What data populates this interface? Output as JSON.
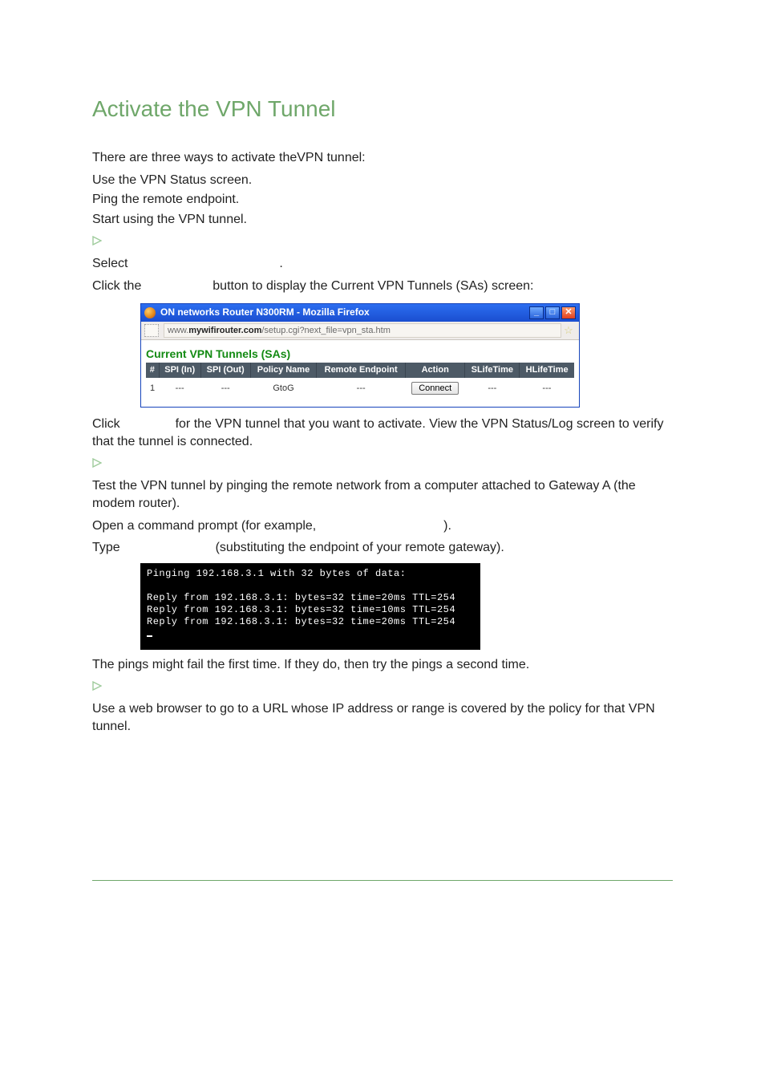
{
  "heading": "Activate the VPN Tunnel",
  "intro": "There are three ways to activate theVPN tunnel:",
  "ways": [
    "Use the VPN Status screen.",
    "Ping the remote endpoint.",
    "Start using the VPN tunnel."
  ],
  "sectionA": {
    "step1_pre": "Select",
    "step1_post": ".",
    "step2_pre": "Click the",
    "step2_post": "button to display the Current VPN Tunnels (SAs) screen:",
    "click_connect_pre": "Click",
    "click_connect_post": "for the VPN tunnel that you want to activate. View the VPN Status/Log screen to verify that the tunnel is connected."
  },
  "firefox": {
    "title": "ON networks Router N300RM - Mozilla Firefox",
    "url_plain_prefix": "www.",
    "url_bold": "mywifirouter.com",
    "url_plain_suffix": "/setup.cgi?next_file=vpn_sta.htm",
    "panel_title": "Current VPN Tunnels (SAs)",
    "win_min": "_",
    "win_max": "□",
    "win_close": "✕",
    "star": "☆",
    "headers": [
      "#",
      "SPI (In)",
      "SPI (Out)",
      "Policy Name",
      "Remote Endpoint",
      "Action",
      "SLifeTime",
      "HLifeTime"
    ],
    "row": {
      "num": "1",
      "spi_in": "---",
      "spi_out": "---",
      "policy": "GtoG",
      "remote": "---",
      "action_label": "Connect",
      "slife": "---",
      "hlife": "---"
    }
  },
  "sectionB": {
    "p1": "Test the VPN tunnel by pinging the remote network from a computer attached to Gateway A (the modem router).",
    "p2_pre": "Open a command prompt (for example,",
    "p2_post": ").",
    "p3_pre": "Type",
    "p3_post": "(substituting the endpoint of your remote gateway)."
  },
  "terminal": {
    "line1": "Pinging 192.168.3.1 with 32 bytes of data:",
    "line2": "Reply from 192.168.3.1: bytes=32 time=20ms TTL=254",
    "line3": "Reply from 192.168.3.1: bytes=32 time=10ms TTL=254",
    "line4": "Reply from 192.168.3.1: bytes=32 time=20ms TTL=254"
  },
  "after_term": "The pings might fail the first time. If they do, then try the pings a second time.",
  "sectionC": {
    "p1": "Use a web browser to go to a URL whose IP address or range is covered by the policy for that VPN tunnel."
  }
}
